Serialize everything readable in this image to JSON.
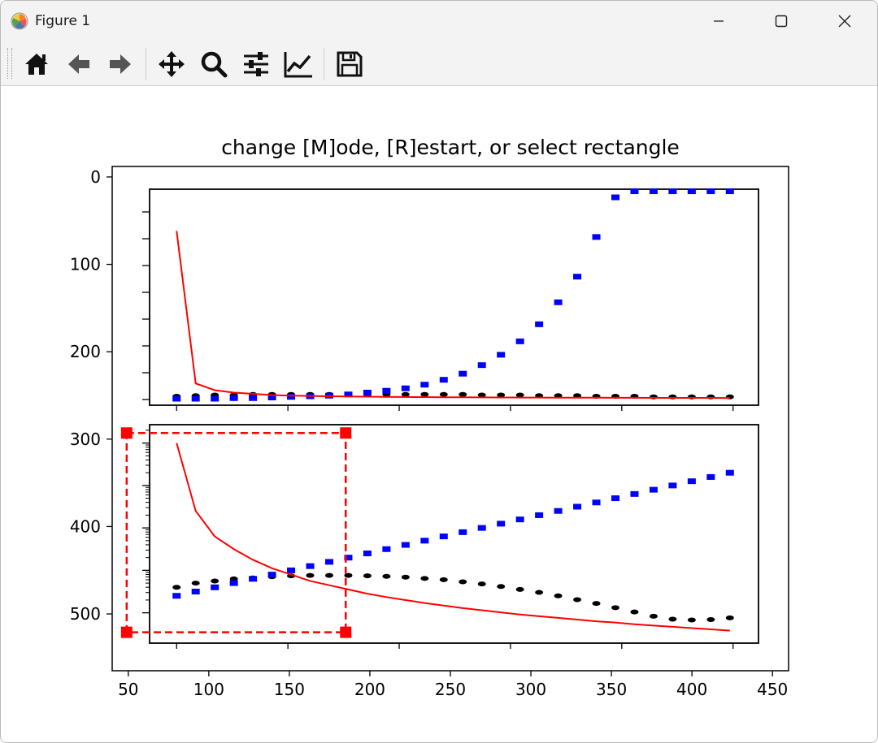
{
  "window": {
    "title": "Figure 1",
    "controls": [
      "minimize",
      "maximize",
      "close"
    ]
  },
  "toolbar": {
    "buttons": [
      {
        "name": "home",
        "icon": "home-icon"
      },
      {
        "name": "back",
        "icon": "arrow-left-icon"
      },
      {
        "name": "forward",
        "icon": "arrow-right-icon"
      },
      {
        "name": "pan",
        "icon": "move-icon"
      },
      {
        "name": "zoom",
        "icon": "magnifier-icon"
      },
      {
        "name": "subplots",
        "icon": "sliders-icon"
      },
      {
        "name": "edit-axes",
        "icon": "line-chart-icon"
      },
      {
        "name": "save",
        "icon": "floppy-disk-icon"
      }
    ]
  },
  "figure": {
    "title": "change [M]ode, [R]estart, or select rectangle",
    "colors": {
      "black_series": "#000000",
      "blue_series": "#0000ff",
      "red_series": "#ff0000",
      "selector": "#ff0000"
    }
  },
  "chart_data": [
    {
      "type": "scatter",
      "role": "outer-axes",
      "xlim": [
        40,
        460
      ],
      "ylim": [
        565,
        -12
      ],
      "x_ticks": [
        50,
        100,
        150,
        200,
        250,
        300,
        350,
        400,
        450
      ],
      "y_ticks": [
        0,
        100,
        200,
        300,
        400,
        500
      ],
      "rectangle_selector": {
        "x": [
          49,
          185
        ],
        "y": [
          293,
          521
        ],
        "style": "dashed",
        "handles": 4
      }
    },
    {
      "type": "line",
      "role": "inset-top",
      "xlim": [
        63,
        446
      ],
      "ylim": [
        0,
        0.0033
      ],
      "log_y": false,
      "x_ticks": [
        80,
        150,
        220,
        290,
        360,
        430
      ],
      "x": [
        80,
        92,
        104,
        116,
        128,
        140,
        152,
        164,
        176,
        188,
        200,
        212,
        224,
        236,
        248,
        260,
        272,
        284,
        296,
        308,
        320,
        332,
        344,
        356,
        368,
        380,
        392,
        404,
        416,
        428
      ],
      "series": [
        {
          "style": "dotted",
          "color": "#000000",
          "values": [
            4e-05,
            5e-05,
            6e-05,
            6e-05,
            7e-05,
            7e-05,
            7e-05,
            7e-05,
            7e-05,
            7e-05,
            7e-05,
            7e-05,
            7e-05,
            7e-05,
            7e-05,
            7e-05,
            6e-05,
            6e-05,
            6e-05,
            5e-05,
            5e-05,
            5e-05,
            4e-05,
            4e-05,
            4e-05,
            3e-05,
            3e-05,
            3e-05,
            3e-05,
            3e-05
          ]
        },
        {
          "style": "dotted",
          "color": "#0000ff",
          "values": [
            0.0,
            0.0,
            0.0,
            1e-05,
            1e-05,
            2e-05,
            3e-05,
            4e-05,
            5e-05,
            7e-05,
            0.0001,
            0.00013,
            0.00017,
            0.00023,
            0.00031,
            0.00041,
            0.00055,
            0.00072,
            0.00094,
            0.00122,
            0.00158,
            0.002,
            0.00265,
            0.0033,
            0.0042,
            0.0053,
            0.0067,
            0.0085,
            0.0105,
            0.013
          ]
        },
        {
          "style": "solid",
          "color": "#ff0000",
          "values": [
            0.00275,
            0.00025,
            0.00014,
            0.0001,
            8e-05,
            6e-05,
            5e-05,
            4.5e-05,
            4e-05,
            3.6e-05,
            3.3e-05,
            3e-05,
            2.8e-05,
            2.6e-05,
            2.4e-05,
            2.3e-05,
            2.1e-05,
            2e-05,
            1.9e-05,
            1.8e-05,
            1.7e-05,
            1.7e-05,
            1.6e-05,
            1.5e-05,
            1.5e-05,
            1.4e-05,
            1.4e-05,
            1.3e-05,
            1.3e-05,
            1.2e-05
          ]
        }
      ]
    },
    {
      "type": "line",
      "role": "inset-bottom",
      "xlim": [
        63,
        446
      ],
      "log_y": true,
      "x_ticks": [
        80,
        150,
        220,
        290,
        360,
        430
      ],
      "x": [
        80,
        92,
        104,
        116,
        128,
        140,
        152,
        164,
        176,
        188,
        200,
        212,
        224,
        236,
        248,
        260,
        272,
        284,
        296,
        308,
        320,
        332,
        344,
        356,
        368,
        380,
        392,
        404,
        416,
        428
      ],
      "series": [
        {
          "style": "dotted",
          "color": "#000000",
          "log10_values": [
            -2.4,
            -2.3,
            -2.25,
            -2.2,
            -2.18,
            -2.15,
            -2.13,
            -2.12,
            -2.12,
            -2.12,
            -2.13,
            -2.14,
            -2.16,
            -2.19,
            -2.22,
            -2.27,
            -2.32,
            -2.38,
            -2.45,
            -2.52,
            -2.6,
            -2.69,
            -2.78,
            -2.88,
            -2.98,
            -3.08,
            -3.15,
            -3.17,
            -3.16,
            -3.12
          ]
        },
        {
          "style": "dotted",
          "color": "#0000ff",
          "log10_values": [
            -2.6,
            -2.5,
            -2.4,
            -2.3,
            -2.2,
            -2.1,
            -2.0,
            -1.9,
            -1.8,
            -1.7,
            -1.6,
            -1.5,
            -1.4,
            -1.3,
            -1.2,
            -1.1,
            -1.0,
            -0.9,
            -0.8,
            -0.7,
            -0.6,
            -0.5,
            -0.4,
            -0.3,
            -0.2,
            -0.1,
            0.0,
            0.1,
            0.2,
            0.3
          ]
        },
        {
          "style": "solid",
          "color": "#ff0000",
          "log10_values": [
            1.0,
            -0.6,
            -1.2,
            -1.5,
            -1.75,
            -1.95,
            -2.1,
            -2.25,
            -2.35,
            -2.45,
            -2.55,
            -2.63,
            -2.7,
            -2.77,
            -2.83,
            -2.89,
            -2.94,
            -2.99,
            -3.04,
            -3.08,
            -3.12,
            -3.16,
            -3.2,
            -3.23,
            -3.27,
            -3.3,
            -3.33,
            -3.36,
            -3.39,
            -3.42
          ]
        }
      ]
    }
  ]
}
